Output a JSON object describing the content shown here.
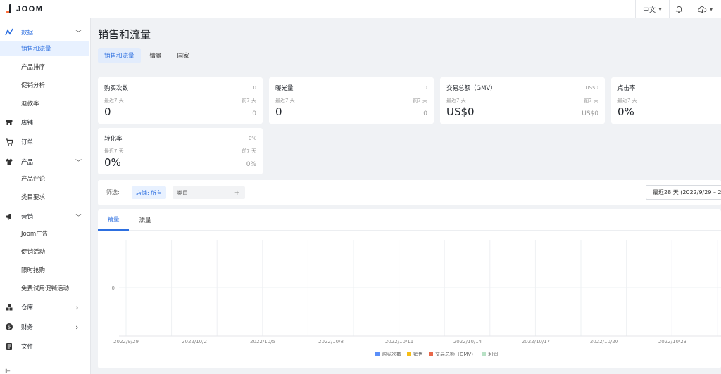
{
  "app": {
    "logo": "JOOM"
  },
  "header": {
    "language": "中文",
    "bell_icon": "bell-icon",
    "cloud_icon": "cloud-icon"
  },
  "sidebar": {
    "items": [
      {
        "label": "数据",
        "icon": "trend-icon",
        "expanded": true,
        "sub": [
          "销售和流量",
          "产品排序",
          "促销分析",
          "退款率"
        ]
      },
      {
        "label": "店铺",
        "icon": "store-icon"
      },
      {
        "label": "订单",
        "icon": "cart-icon"
      },
      {
        "label": "产品",
        "icon": "shirt-icon",
        "expanded": true,
        "sub": [
          "产品评论",
          "类目要求"
        ]
      },
      {
        "label": "营销",
        "icon": "megaphone-icon",
        "expanded": true,
        "sub": [
          "Joom广告",
          "促销活动",
          "限时抢购",
          "免费试用促销活动"
        ]
      },
      {
        "label": "仓库",
        "icon": "warehouse-icon"
      },
      {
        "label": "财务",
        "icon": "dollar-icon"
      },
      {
        "label": "文件",
        "icon": "document-icon"
      }
    ],
    "active_sub": "销售和流量",
    "accent": "#2d6fe0"
  },
  "page": {
    "title": "销售和流量",
    "tabs": [
      "销售和流量",
      "情景",
      "国家"
    ],
    "active_tab": "销售和流量"
  },
  "metrics": [
    {
      "title": "购买次数",
      "total": "0",
      "period": "最近7 天",
      "period_r": "前7 天",
      "value": "0",
      "value_r": "0"
    },
    {
      "title": "曝光量",
      "total": "0",
      "period": "最近7 天",
      "period_r": "前7 天",
      "value": "0",
      "value_r": "0"
    },
    {
      "title": "交易总额（GMV）",
      "total": "US$0",
      "period": "最近7 天",
      "period_r": "前7 天",
      "value": "US$0",
      "value_r": "US$0"
    },
    {
      "title": "点击率",
      "total": "",
      "period": "最近7 天",
      "period_r": "",
      "value": "0%",
      "value_r": ""
    },
    {
      "title": "转化率",
      "total": "0%",
      "period": "最近7 天",
      "period_r": "前7 天",
      "value": "0%",
      "value_r": "0%"
    }
  ],
  "filter": {
    "label": "筛选:",
    "store_chip": "店铺: 所有",
    "category_placeholder": "类目",
    "date_range": "最近28 天 (2022/9/29 – 2"
  },
  "chart_tabs": [
    "销量",
    "流量"
  ],
  "chart_data": {
    "type": "line",
    "x": [
      "2022/9/29",
      "2022/10/2",
      "2022/10/5",
      "2022/10/8",
      "2022/10/11",
      "2022/10/14",
      "2022/10/17",
      "2022/10/20",
      "2022/10/23"
    ],
    "y_ticks": [
      "0"
    ],
    "series": [
      {
        "name": "购买次数",
        "color": "#5b8ff9",
        "values": [
          0,
          0,
          0,
          0,
          0,
          0,
          0,
          0,
          0
        ]
      },
      {
        "name": "销售",
        "color": "#f6bd16",
        "values": [
          0,
          0,
          0,
          0,
          0,
          0,
          0,
          0,
          0
        ]
      },
      {
        "name": "交易总额（GMV）",
        "color": "#e8684a",
        "values": [
          0,
          0,
          0,
          0,
          0,
          0,
          0,
          0,
          0
        ]
      },
      {
        "name": "利润",
        "color": "#b8e1c5",
        "values": [
          0,
          0,
          0,
          0,
          0,
          0,
          0,
          0,
          0
        ]
      }
    ],
    "grid": true,
    "legend": "bottom-center"
  }
}
